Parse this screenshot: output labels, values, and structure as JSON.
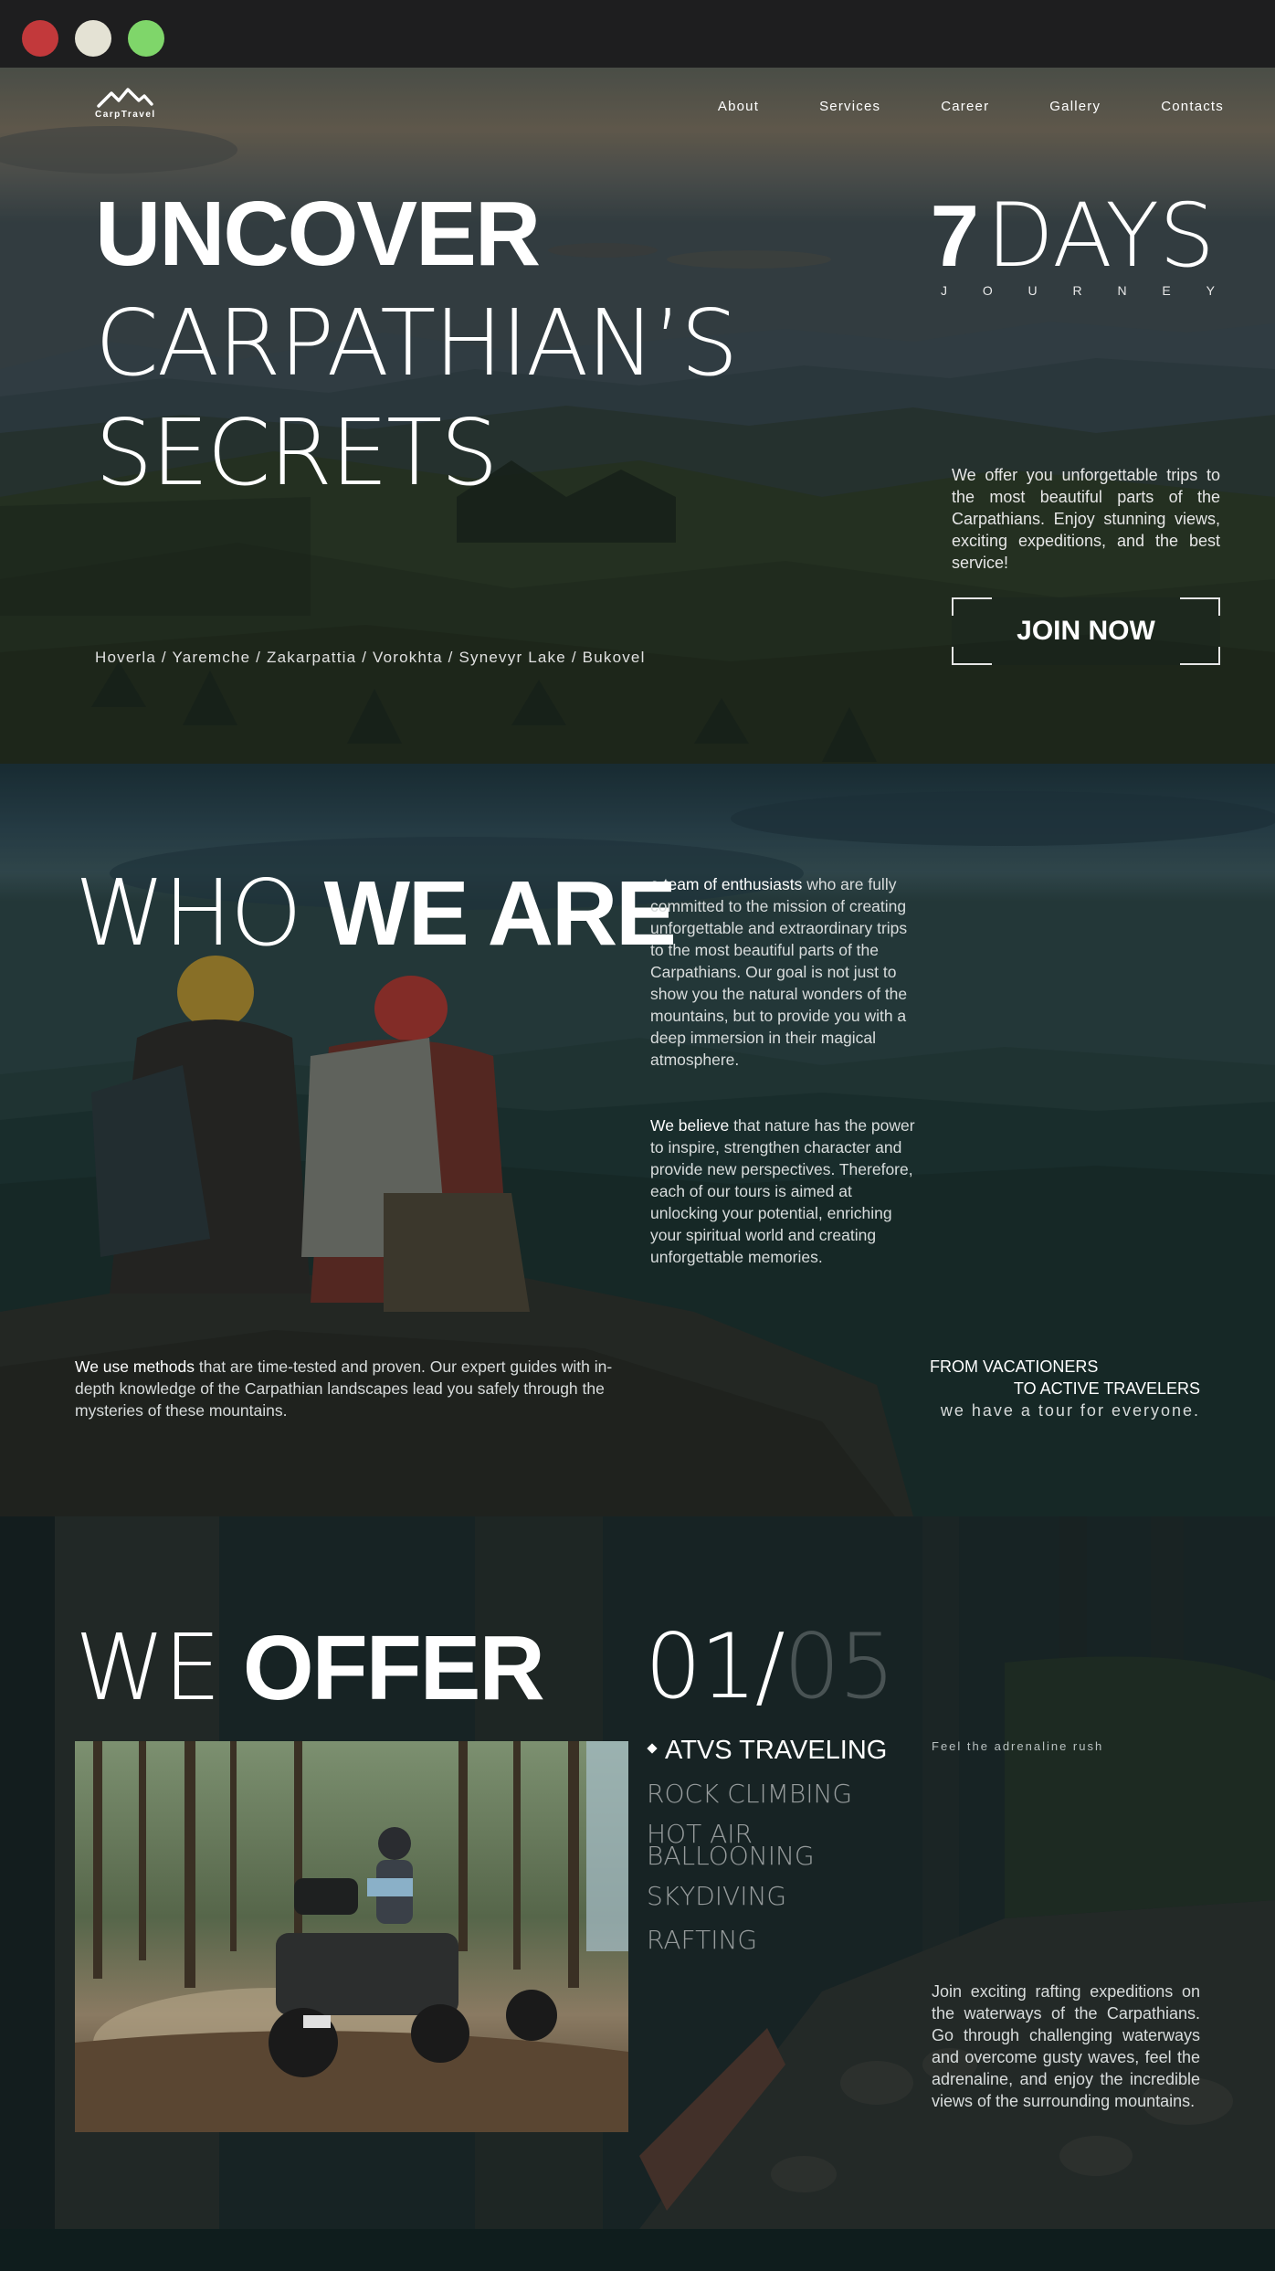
{
  "window": {
    "controls": [
      "close",
      "minimize",
      "maximize"
    ]
  },
  "header": {
    "logo_text": "CarpTravel",
    "nav": [
      "About",
      "Services",
      "Career",
      "Gallery",
      "Contacts"
    ]
  },
  "hero": {
    "title_line1": "UNCOVER",
    "title_line2": "CARPATHIAN’S",
    "title_line3": "SECRETS",
    "days_number": "7",
    "days_word": "DAYS",
    "journey_letters": [
      "J",
      "O",
      "U",
      "R",
      "N",
      "E",
      "Y"
    ],
    "description": "We offer you unforgettable trips to the most beautiful parts of the Carpathians. Enjoy stunning views, exciting expeditions, and the best service!",
    "join_label": "JOIN NOW",
    "places": "Hoverla / Yaremche / Zakarpattia / Vorokhta / Synevyr Lake / Bukovel"
  },
  "who": {
    "title_light": "WHO",
    "title_bold": "WE ARE",
    "p1_lead": "a team of enthusiasts",
    "p1_text": " who are fully committed to the mission of creating unforgettable and extraordinary trips to the most beautiful parts of the Carpathians. Our goal is not just to show you the natural wonders of the mountains, but to provide you with a deep immersion in their magical atmosphere.",
    "p2_lead": "We believe",
    "p2_text": " that nature has the power to inspire, strengthen character and provide new perspectives. Therefore, each of our tours is aimed at unlocking your potential, enriching your spiritual world and creating unforgettable memories.",
    "p3_lead": "We use methods",
    "p3_text": " that are time-tested and proven. Our expert guides with in-depth knowledge of the Carpathian landscapes lead you safely through the mysteries of these mountains.",
    "from_line1": "FROM VACATIONERS",
    "from_line2": "TO ACTIVE TRAVELERS",
    "from_line3": "we have a tour for everyone."
  },
  "offer": {
    "title_light": "WE",
    "title_bold": "OFFER",
    "counter_current": "01/",
    "counter_total": "05",
    "items": [
      {
        "label": "ATVS TRAVELING",
        "active": true
      },
      {
        "label": "ROCK CLIMBING",
        "active": false
      },
      {
        "label": "HOT AIR BALLOONING",
        "active": false
      },
      {
        "label": "SKYDIVING",
        "active": false
      },
      {
        "label": "RAFTING",
        "active": false
      }
    ],
    "tagline": "Feel the adrenaline rush",
    "description": "Join exciting rafting expeditions on the waterways of the Carpathians. Go through challenging waterways and overcome gusty waves, feel the adrenaline, and enjoy the incredible views of the surrounding mountains."
  }
}
